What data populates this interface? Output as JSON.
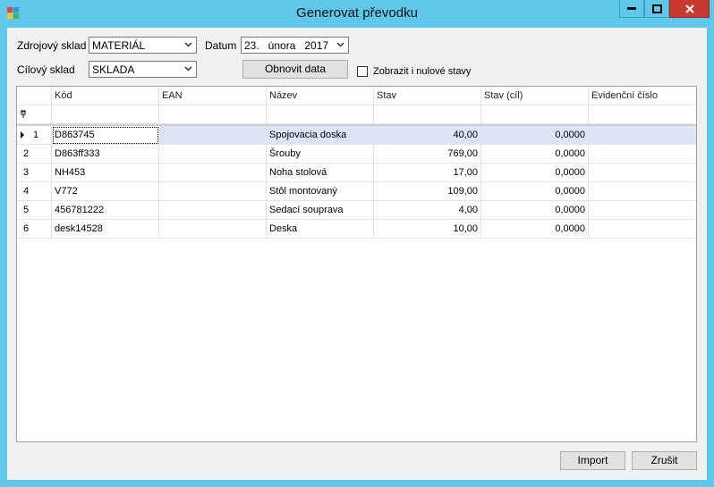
{
  "window": {
    "title": "Generovat převodku"
  },
  "form": {
    "source_label": "Zdrojový sklad",
    "source_value": "MATERIÁL",
    "date_label": "Datum",
    "date_value": "23.   února   2017",
    "target_label": "Cílový sklad",
    "target_value": "SKLADA",
    "refresh_label": "Obnovit data",
    "show_zero_label": "Zobrazit i nulové stavy"
  },
  "grid": {
    "columns": [
      "Kód",
      "EAN",
      "Název",
      "Stav",
      "Stav (cíl)",
      "Evidenční číslo"
    ],
    "rows": [
      {
        "num": "1",
        "kod": "D863745",
        "ean": "",
        "nazev": "Spojovacia doska",
        "stav": "40,00",
        "stav_cil": "0,0000",
        "evid": ""
      },
      {
        "num": "2",
        "kod": "D863ff333",
        "ean": "",
        "nazev": "Šrouby",
        "stav": "769,00",
        "stav_cil": "0,0000",
        "evid": ""
      },
      {
        "num": "3",
        "kod": "NH453",
        "ean": "",
        "nazev": "Noha stolová",
        "stav": "17,00",
        "stav_cil": "0,0000",
        "evid": ""
      },
      {
        "num": "4",
        "kod": "V772",
        "ean": "",
        "nazev": "Stôl montovaný",
        "stav": "109,00",
        "stav_cil": "0,0000",
        "evid": ""
      },
      {
        "num": "5",
        "kod": "456781222",
        "ean": "",
        "nazev": "Sedací souprava",
        "stav": "4,00",
        "stav_cil": "0,0000",
        "evid": ""
      },
      {
        "num": "6",
        "kod": "desk14528",
        "ean": "",
        "nazev": "Deska",
        "stav": "10,00",
        "stav_cil": "0,0000",
        "evid": ""
      }
    ]
  },
  "footer": {
    "import_label": "Import",
    "cancel_label": "Zrušit"
  },
  "icons": {
    "app": "app-icon",
    "filter": "filter-icon",
    "row_selector": "row-pointer-icon"
  }
}
